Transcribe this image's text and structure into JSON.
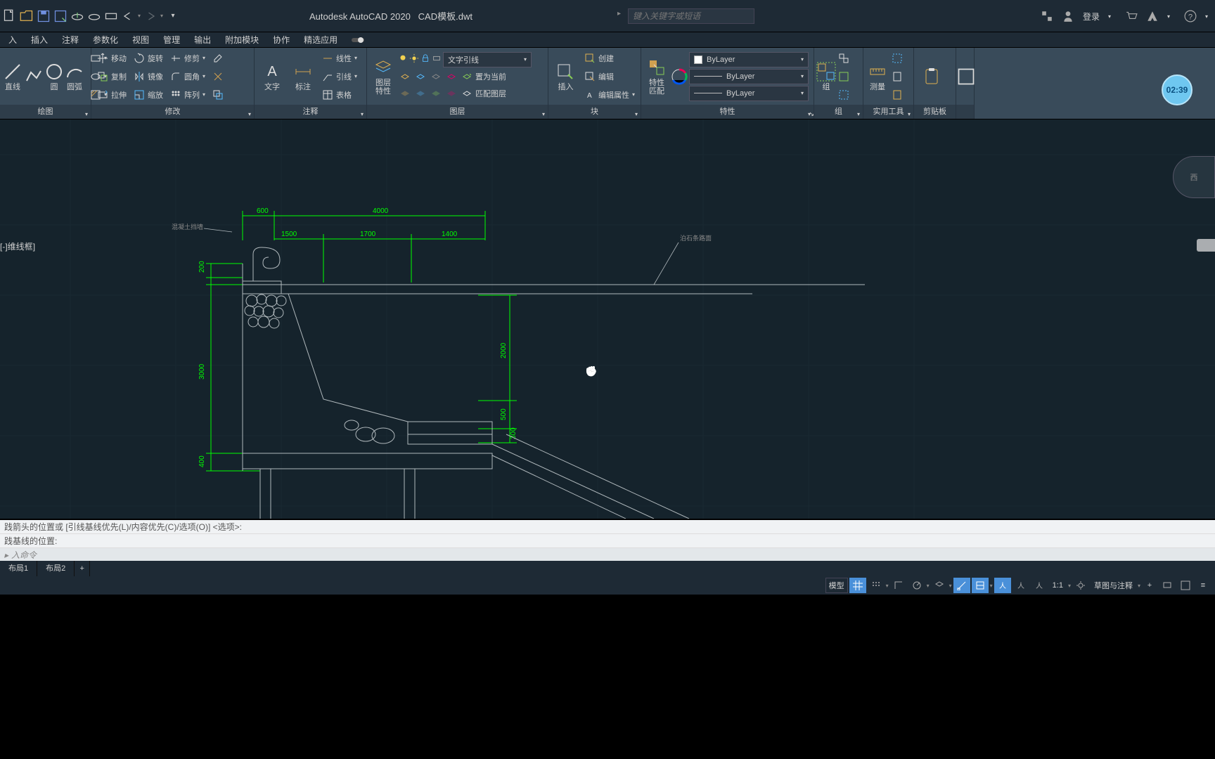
{
  "titlebar": {
    "appname": "Autodesk AutoCAD 2020",
    "filename": "CAD模板.dwt",
    "search_placeholder": "键入关键字或短语",
    "login": "登录"
  },
  "menu": {
    "tabs": [
      "入",
      "插入",
      "注释",
      "参数化",
      "视图",
      "管理",
      "输出",
      "附加模块",
      "协作",
      "精选应用"
    ]
  },
  "ribbon": {
    "draw": {
      "title": "绘图",
      "line": "直线",
      "polyline": "",
      "circle": "圆",
      "arc": "圆弧"
    },
    "modify": {
      "title": "修改",
      "move": "移动",
      "rotate": "旋转",
      "trim": "修剪",
      "copy": "复制",
      "mirror": "镜像",
      "fillet": "圆角",
      "stretch": "拉伸",
      "scale": "缩放",
      "array": "阵列"
    },
    "annot": {
      "title": "注释",
      "text": "文字",
      "dim": "标注",
      "leader": "引线",
      "table": "表格",
      "linear": "线性"
    },
    "layers": {
      "title": "图层",
      "props": "图层\n特性",
      "current": "文字引线",
      "setc": "置为当前",
      "match": "匹配图层"
    },
    "block": {
      "title": "块",
      "insert": "插入",
      "create": "创建",
      "edit": "编辑",
      "editattr": "编辑属性"
    },
    "props": {
      "title": "特性",
      "match": "特性\n匹配",
      "bylayer": "ByLayer"
    },
    "group": {
      "title": "组",
      "g": "组"
    },
    "util": {
      "title": "实用工具",
      "measure": "测量"
    },
    "clip": {
      "title": "剪贴板"
    }
  },
  "canvas": {
    "status": "维线框",
    "viewcube": "西",
    "dims": {
      "d600": "600",
      "d4000": "4000",
      "d1500": "1500",
      "d1700": "1700",
      "d1400": "1400",
      "d200": "200",
      "d3000": "3000",
      "d400": "400",
      "d2000": "2000",
      "d500": "500",
      "d300": "300"
    },
    "labels": {
      "l1": "混凝土挡墙",
      "l2": "泊石条路面"
    }
  },
  "cmd": {
    "line1": "践箭头的位置或 [引线基线优先(L)/内容优先(C)/选项(O)] <选项>:",
    "line2": "践基线的位置:",
    "prompt": "入命令"
  },
  "sheets": {
    "t1": "布局1",
    "t2": "布局2"
  },
  "statusbar": {
    "model": "模型",
    "scale": "1:1",
    "annoset": "草图与注释",
    "iso_label": ""
  },
  "clock": "02:39"
}
